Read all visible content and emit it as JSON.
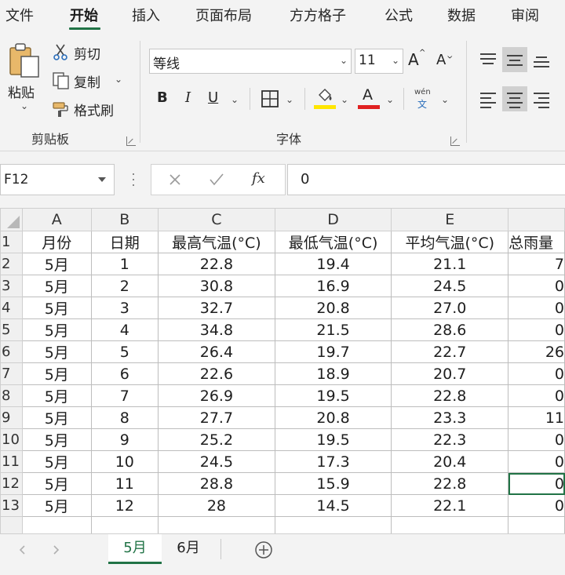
{
  "menu": {
    "tabs": [
      "文件",
      "开始",
      "插入",
      "页面布局",
      "方方格子",
      "公式",
      "数据",
      "审阅"
    ],
    "active": "开始"
  },
  "ribbon": {
    "clipboard": {
      "paste_label": "粘贴",
      "cut_label": "剪切",
      "copy_label": "复制",
      "format_painter_label": "格式刷",
      "group_label": "剪贴板"
    },
    "font": {
      "font_name": "等线",
      "font_size": "11",
      "grow_label": "A",
      "shrink_label": "A",
      "bold_label": "B",
      "italic_label": "I",
      "underline_label": "U",
      "font_color_label": "A",
      "phonetic_top": "wén",
      "phonetic_bottom": "文",
      "group_label": "字体",
      "highlight_color": "#ffe600",
      "font_color": "#e02020"
    }
  },
  "formula_bar": {
    "name_box": "F12",
    "fx_label": "fx",
    "value": "0"
  },
  "grid": {
    "columns": [
      "A",
      "B",
      "C",
      "D",
      "E",
      ""
    ],
    "row_numbers": [
      "1",
      "2",
      "3",
      "4",
      "5",
      "6",
      "7",
      "8",
      "9",
      "10",
      "11",
      "12",
      "13",
      ""
    ],
    "rows": [
      [
        "月份",
        "日期",
        "最高气温(°C)",
        "最低气温(°C)",
        "平均气温(°C)",
        "总雨量"
      ],
      [
        "5月",
        "1",
        "22.8",
        "19.4",
        "21.1",
        "7"
      ],
      [
        "5月",
        "2",
        "30.8",
        "16.9",
        "24.5",
        "0"
      ],
      [
        "5月",
        "3",
        "32.7",
        "20.8",
        "27.0",
        "0"
      ],
      [
        "5月",
        "4",
        "34.8",
        "21.5",
        "28.6",
        "0"
      ],
      [
        "5月",
        "5",
        "26.4",
        "19.7",
        "22.7",
        "26"
      ],
      [
        "5月",
        "6",
        "22.6",
        "18.9",
        "20.7",
        "0"
      ],
      [
        "5月",
        "7",
        "26.9",
        "19.5",
        "22.8",
        "0"
      ],
      [
        "5月",
        "8",
        "27.7",
        "20.8",
        "23.3",
        "11"
      ],
      [
        "5月",
        "9",
        "25.2",
        "19.5",
        "22.3",
        "0"
      ],
      [
        "5月",
        "10",
        "24.5",
        "17.3",
        "20.4",
        "0"
      ],
      [
        "5月",
        "11",
        "28.8",
        "15.9",
        "22.8",
        "0"
      ],
      [
        "5月",
        "12",
        "28",
        "14.5",
        "22.1",
        "0"
      ],
      [
        "",
        "",
        "",
        "",
        "",
        ""
      ]
    ]
  },
  "sheets": {
    "tabs": [
      "5月",
      "6月"
    ],
    "active": "5月"
  },
  "colors": {
    "accent": "#217346"
  }
}
